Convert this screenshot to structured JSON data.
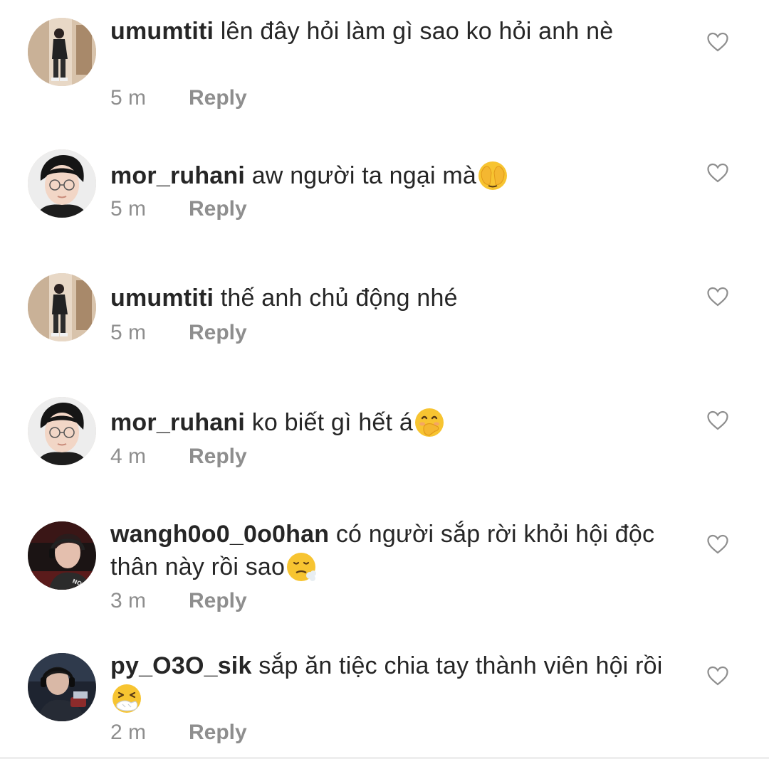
{
  "comments": [
    {
      "username": "umumtiti",
      "text": " lên đây hỏi làm gì sao ko hỏi anh nè",
      "emoji": "",
      "time": "5 m",
      "reply_label": "Reply",
      "avatar_icon": "avatar-photo-mirror-selfie",
      "heart_icon": "heart-outline-icon"
    },
    {
      "username": "mor_ruhani",
      "text": " aw người ta ngại mà",
      "emoji": "face-with-peeking-eye",
      "time": "5 m",
      "reply_label": "Reply",
      "avatar_icon": "avatar-photo-boy-glasses",
      "heart_icon": "heart-outline-icon"
    },
    {
      "username": "umumtiti",
      "text": " thế anh chủ động nhé",
      "emoji": "",
      "time": "5 m",
      "reply_label": "Reply",
      "avatar_icon": "avatar-photo-mirror-selfie",
      "heart_icon": "heart-outline-icon"
    },
    {
      "username": "mor_ruhani",
      "text": " ko biết gì hết á",
      "emoji": "face-with-hand-over-mouth",
      "time": "4 m",
      "reply_label": "Reply",
      "avatar_icon": "avatar-photo-boy-glasses",
      "heart_icon": "heart-outline-icon"
    },
    {
      "username": "wangh0o0_0o0han",
      "text": " có người sắp rời khỏi hội độc thân này rồi sao",
      "emoji": "face-exhaling",
      "time": "3 m",
      "reply_label": "Reply",
      "avatar_icon": "avatar-photo-headset-red",
      "heart_icon": "heart-outline-icon"
    },
    {
      "username": "py_O3O_sik",
      "text": " sắp ăn tiệc chia tay thành viên hội rồi",
      "emoji": "sneezing-face",
      "time": "2 m",
      "reply_label": "Reply",
      "avatar_icon": "avatar-photo-headset-dark",
      "heart_icon": "heart-outline-icon"
    }
  ],
  "colors": {
    "text": "#262626",
    "meta": "#8e8e8e",
    "emoji_yellow": "#f7c431",
    "background": "#ffffff"
  }
}
